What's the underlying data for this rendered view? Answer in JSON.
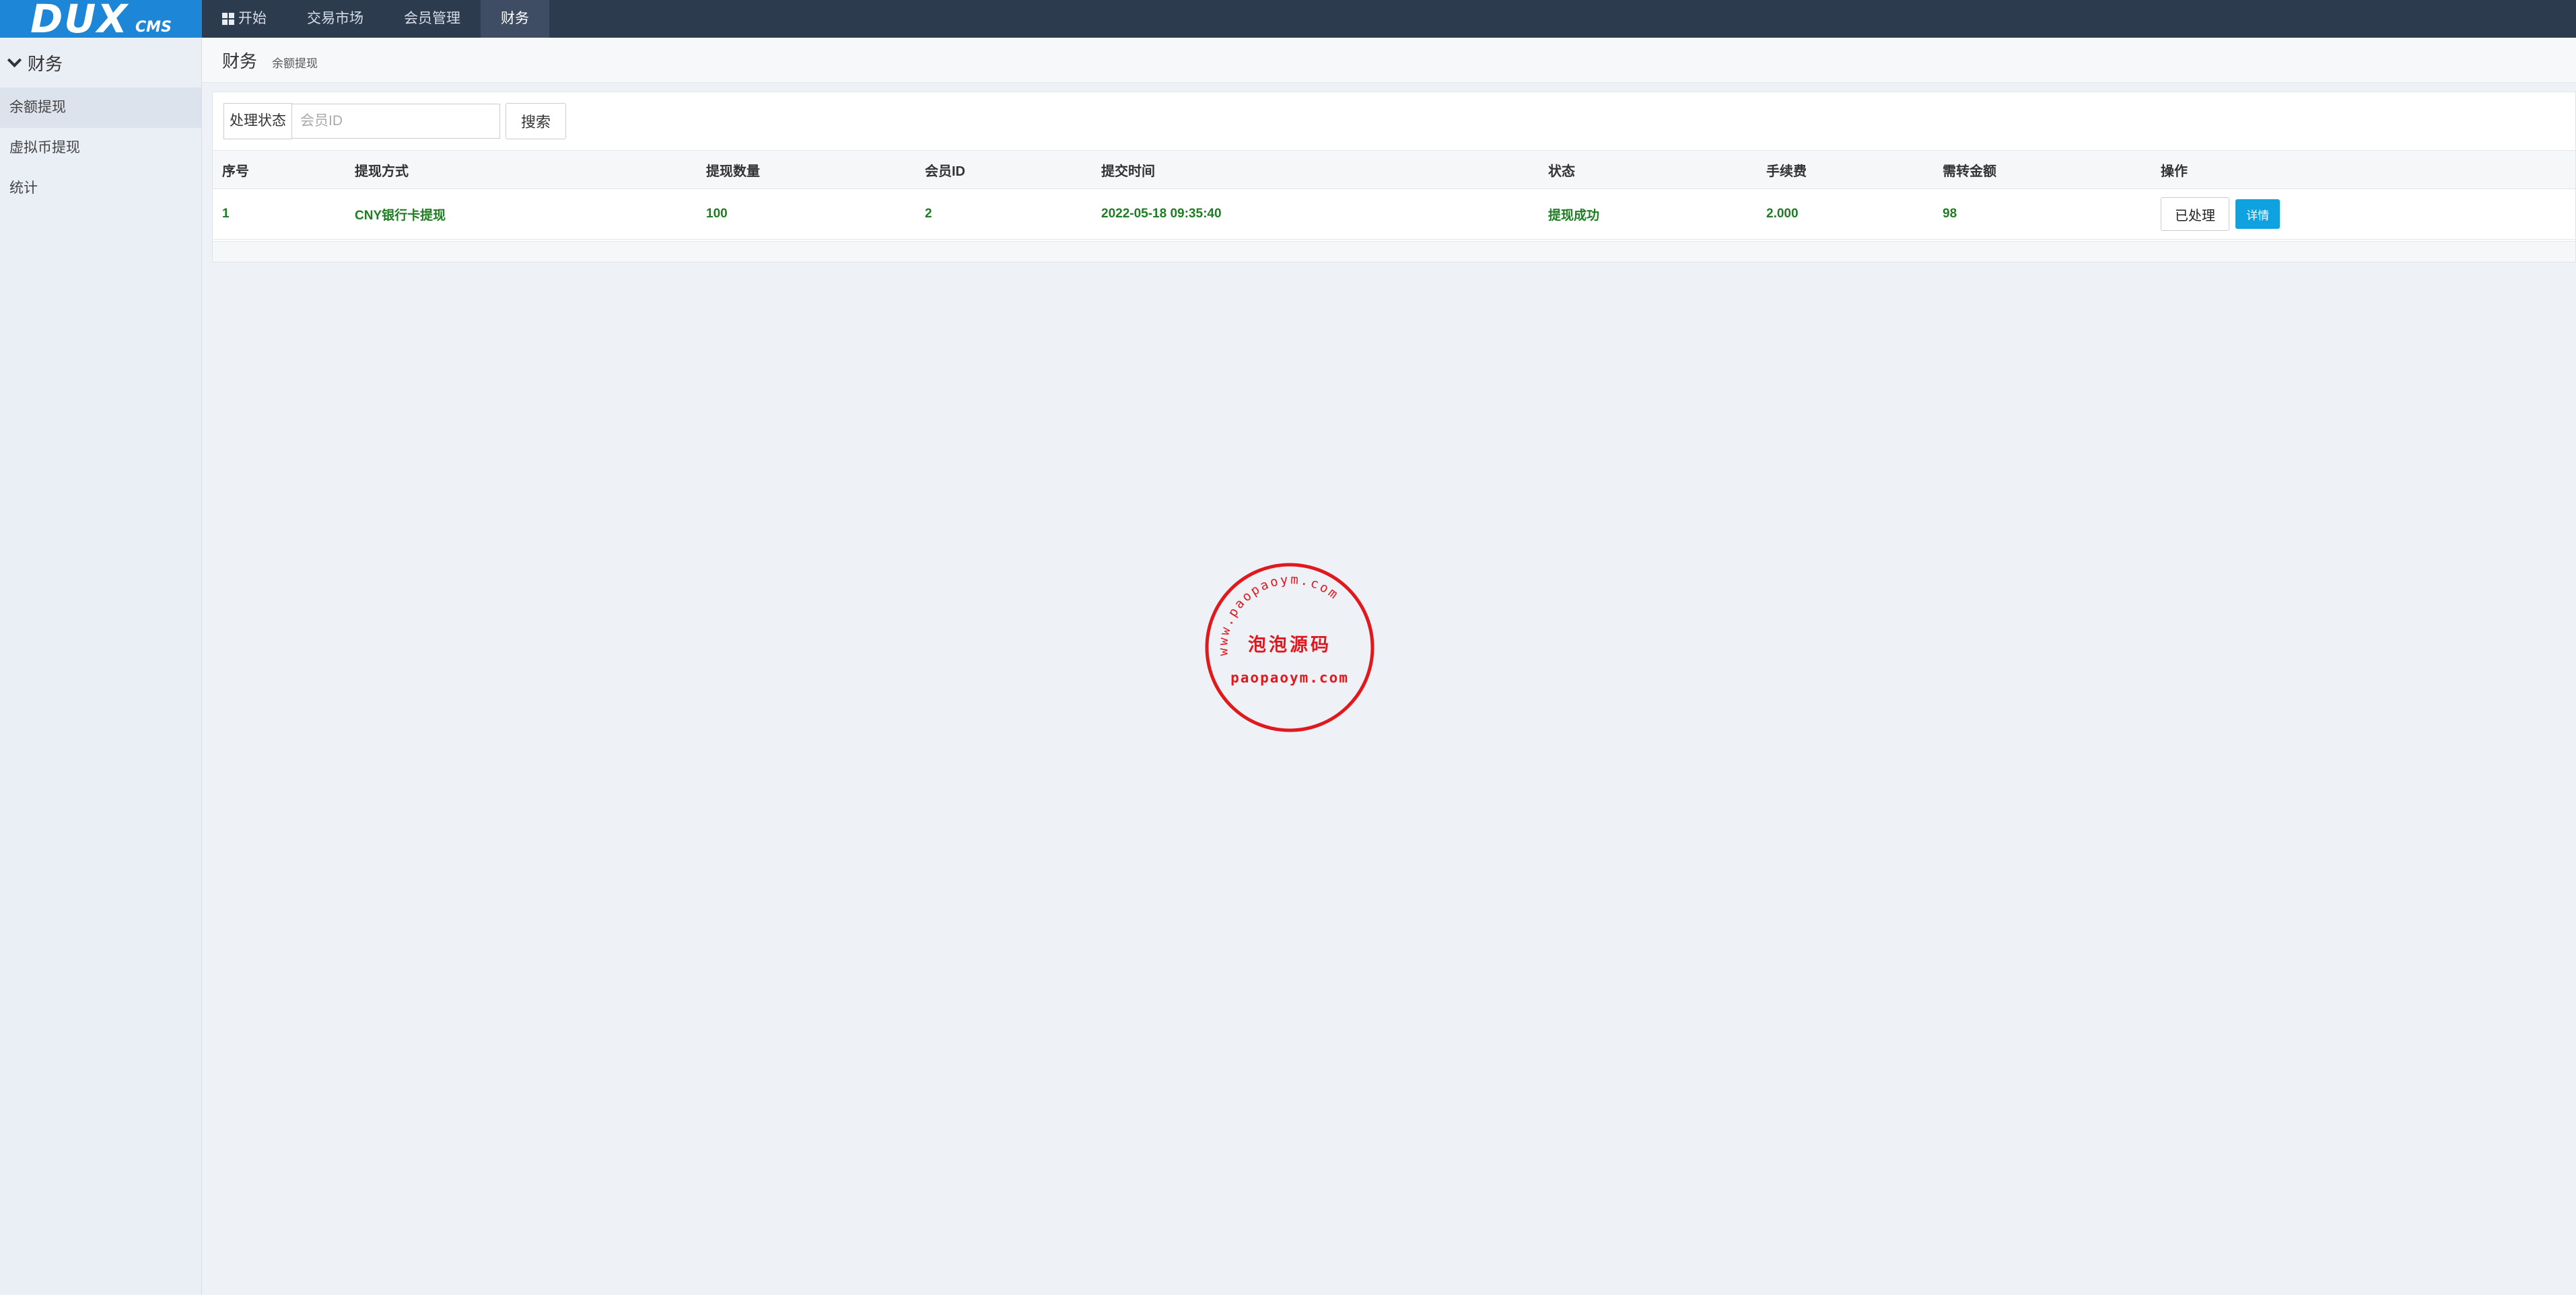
{
  "app": {
    "logo_main": "DUX",
    "logo_sub": "CMS"
  },
  "topnav": [
    {
      "label": "开始",
      "icon": "windows-icon"
    },
    {
      "label": "交易市场"
    },
    {
      "label": "会员管理"
    },
    {
      "label": "财务",
      "active": true
    }
  ],
  "sidebar": {
    "header": "财务",
    "items": [
      {
        "label": "余额提现",
        "active": true
      },
      {
        "label": "虚拟币提现"
      },
      {
        "label": "统计"
      }
    ]
  },
  "breadcrumb": {
    "title": "财务",
    "sub": "余额提现"
  },
  "filter": {
    "label": "处理状态",
    "input_placeholder": "会员ID",
    "input_value": "",
    "search_label": "搜索"
  },
  "table": {
    "headers": [
      "序号",
      "提现方式",
      "提现数量",
      "会员ID",
      "提交时间",
      "状态",
      "手续费",
      "需转金额",
      "操作"
    ],
    "rows": [
      {
        "id": "1",
        "method": "CNY银行卡提现",
        "amount": "100",
        "member_id": "2",
        "time": "2022-05-18 09:35:40",
        "status": "提现成功",
        "fee": "2.000",
        "transfer": "98",
        "action_done": "已处理",
        "action_detail": "详情"
      }
    ]
  },
  "stamp": {
    "top_arc": "www.paopaoym.com",
    "center": "泡泡源码",
    "bottom": "paopaoym.com",
    "color": "#e0191f"
  },
  "colors": {
    "topbar": "#2d3b4f",
    "logo_bg": "#1d86d6",
    "row_text": "#1e7d22",
    "detail_button": "#0fa2e0"
  }
}
